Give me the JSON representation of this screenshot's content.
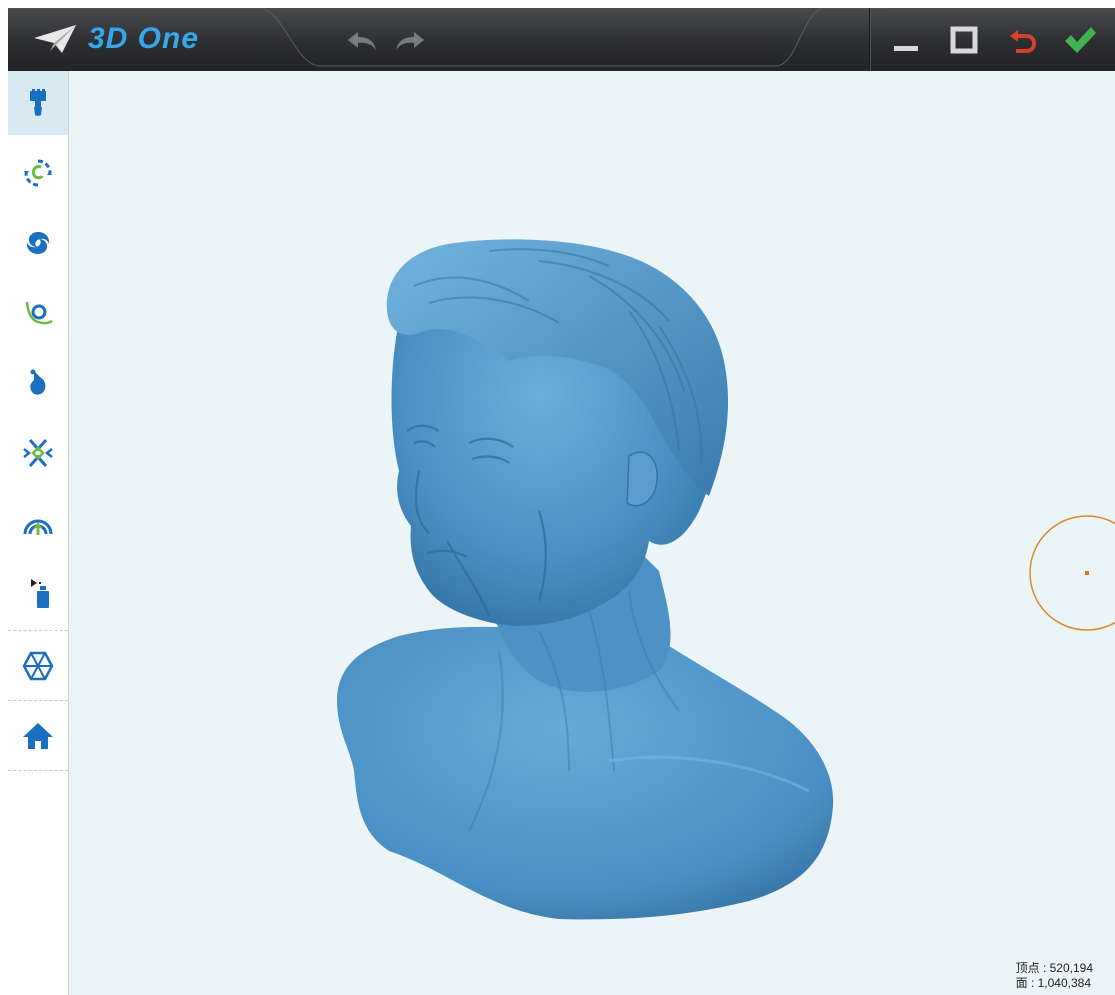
{
  "app": {
    "title": "3D One"
  },
  "sidebar": {
    "tools": [
      {
        "icon": "paint-brush-icon",
        "active": true
      },
      {
        "icon": "rotate-select-icon"
      },
      {
        "icon": "swirl-icon"
      },
      {
        "icon": "curve-loop-icon"
      },
      {
        "icon": "smudge-icon"
      },
      {
        "icon": "pinch-icon"
      },
      {
        "icon": "inflate-icon"
      },
      {
        "icon": "spray-icon"
      },
      {
        "icon": "mesh-view-icon"
      },
      {
        "icon": "home-view-icon"
      }
    ]
  },
  "stats": {
    "vertices_label": "顶点 : 520,194",
    "faces_label": "面 : 1,040,384"
  },
  "colors": {
    "titlebar": "#2d2e31",
    "accent_blue": "#3aa6e6",
    "model_blue": "#4f95c8",
    "viewport_bg": "#ebf4f7",
    "cancel_red": "#d9402b",
    "confirm_green": "#3fb34f",
    "brush_orange": "#d98a2b"
  }
}
